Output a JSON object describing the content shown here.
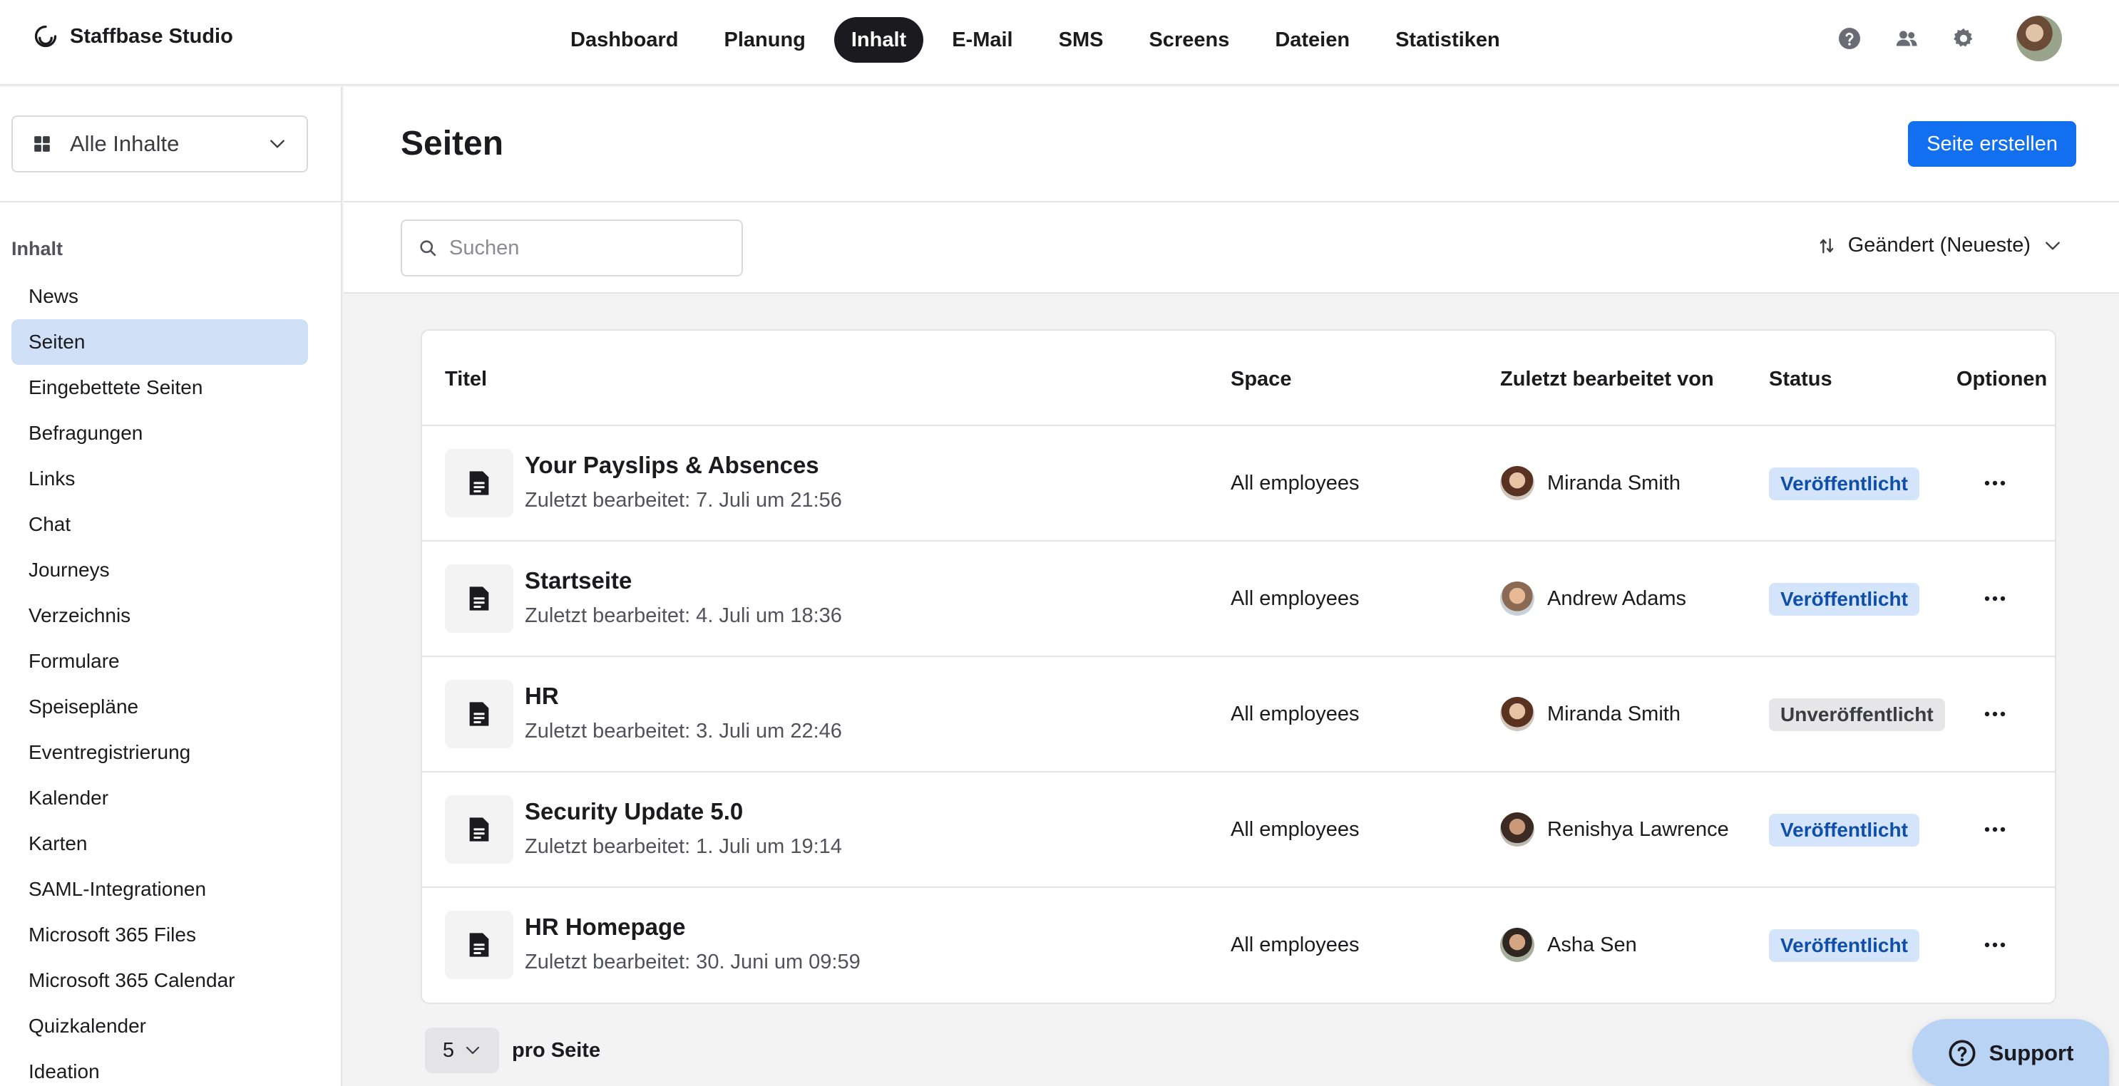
{
  "app": {
    "brand": "Staffbase Studio"
  },
  "nav": {
    "items": [
      {
        "label": "Dashboard",
        "active": false
      },
      {
        "label": "Planung",
        "active": false
      },
      {
        "label": "Inhalt",
        "active": true
      },
      {
        "label": "E-Mail",
        "active": false
      },
      {
        "label": "SMS",
        "active": false
      },
      {
        "label": "Screens",
        "active": false
      },
      {
        "label": "Dateien",
        "active": false
      },
      {
        "label": "Statistiken",
        "active": false
      }
    ],
    "icons": [
      "help-icon",
      "users-icon",
      "gear-icon",
      "user-avatar"
    ]
  },
  "sidebar": {
    "select_label": "Alle Inhalte",
    "section_label": "Inhalt",
    "items": [
      {
        "label": "News",
        "active": false
      },
      {
        "label": "Seiten",
        "active": true
      },
      {
        "label": "Eingebettete Seiten",
        "active": false
      },
      {
        "label": "Befragungen",
        "active": false
      },
      {
        "label": "Links",
        "active": false
      },
      {
        "label": "Chat",
        "active": false
      },
      {
        "label": "Journeys",
        "active": false
      },
      {
        "label": "Verzeichnis",
        "active": false
      },
      {
        "label": "Formulare",
        "active": false
      },
      {
        "label": "Speisepläne",
        "active": false
      },
      {
        "label": "Eventregistrierung",
        "active": false
      },
      {
        "label": "Kalender",
        "active": false
      },
      {
        "label": "Karten",
        "active": false
      },
      {
        "label": "SAML-Integrationen",
        "active": false
      },
      {
        "label": "Microsoft 365 Files",
        "active": false
      },
      {
        "label": "Microsoft 365 Calendar",
        "active": false
      },
      {
        "label": "Quizkalender",
        "active": false
      },
      {
        "label": "Ideation",
        "active": false
      }
    ]
  },
  "main": {
    "title": "Seiten",
    "create_button": "Seite erstellen",
    "search": {
      "placeholder": "Suchen",
      "value": ""
    },
    "sort_label": "Geändert (Neueste)"
  },
  "table": {
    "columns": {
      "title": "Titel",
      "space": "Space",
      "editor": "Zuletzt bearbeitet von",
      "status": "Status",
      "options": "Optionen"
    },
    "rows": [
      {
        "title": "Your Payslips & Absences",
        "subtitle": "Zuletzt bearbeitet: 7. Juli um 21:56",
        "space": "All employees",
        "editor": "Miranda Smith",
        "status": "Veröffentlicht",
        "published": true
      },
      {
        "title": "Startseite",
        "subtitle": "Zuletzt bearbeitet: 4. Juli um 18:36",
        "space": "All employees",
        "editor": "Andrew Adams",
        "status": "Veröffentlicht",
        "published": true
      },
      {
        "title": "HR",
        "subtitle": "Zuletzt bearbeitet: 3. Juli um 22:46",
        "space": "All employees",
        "editor": "Miranda Smith",
        "status": "Unveröffentlicht",
        "published": false
      },
      {
        "title": "Security Update 5.0",
        "subtitle": "Zuletzt bearbeitet: 1. Juli um 19:14",
        "space": "All employees",
        "editor": "Renishya Lawrence",
        "status": "Veröffentlicht",
        "published": true
      },
      {
        "title": "HR Homepage",
        "subtitle": "Zuletzt bearbeitet: 30. Juni um 09:59",
        "space": "All employees",
        "editor": "Asha Sen",
        "status": "Veröffentlicht",
        "published": true
      }
    ]
  },
  "pagination": {
    "per_page_value": "5",
    "per_page_label": "pro Seite"
  },
  "support": {
    "label": "Support"
  },
  "colors": {
    "accent": "#1270f0",
    "nav_active": "#1b1b1f",
    "sidebar_active": "#cfe0f7",
    "badge_published": "#d3e4fb",
    "badge_unpublished": "#e6e6e9",
    "support_bg": "#b9d3f5"
  }
}
